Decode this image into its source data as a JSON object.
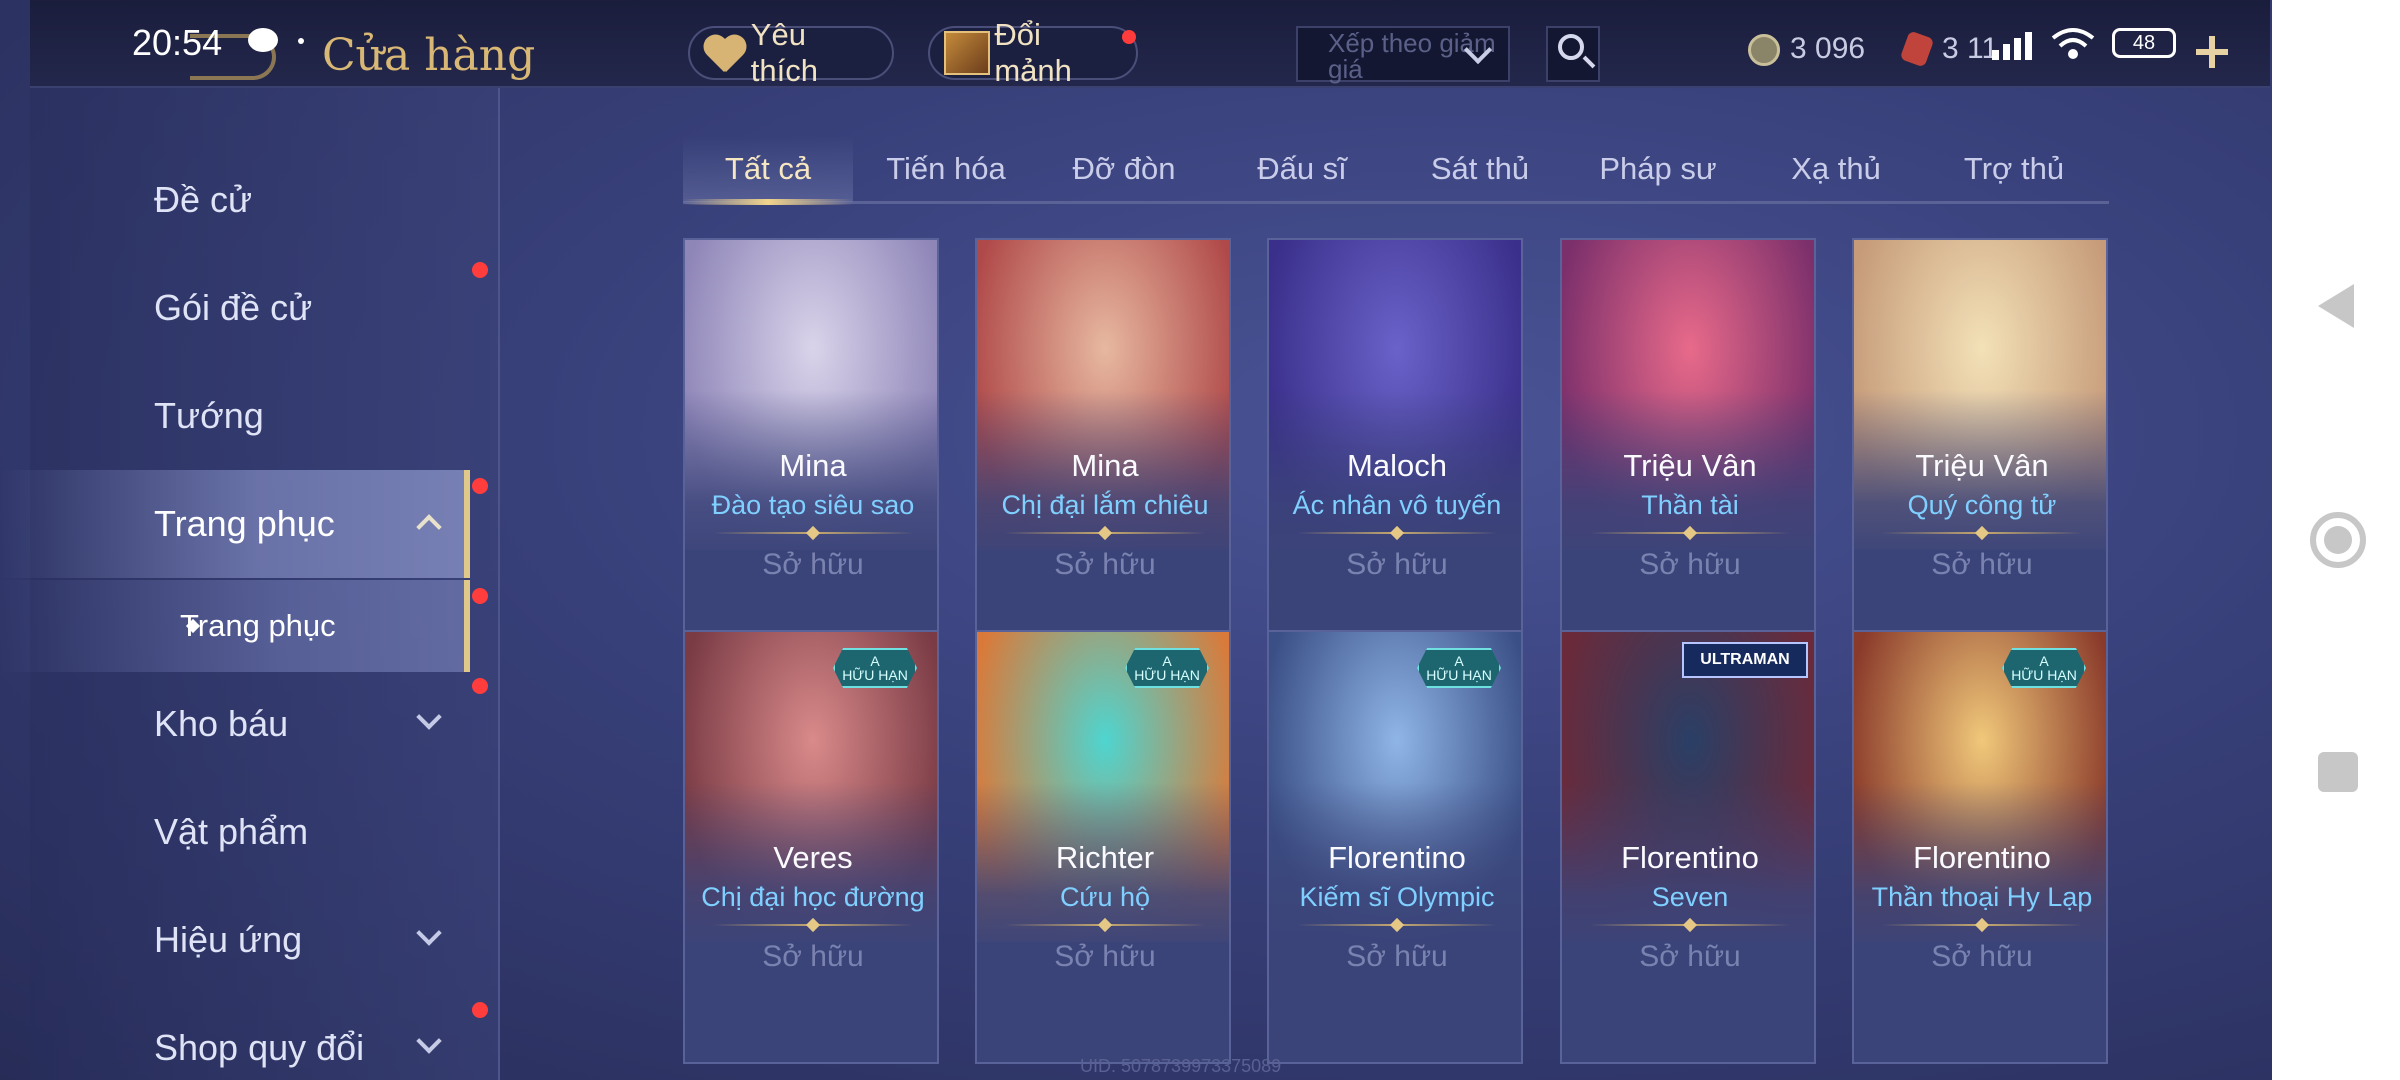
{
  "status": {
    "time": "20:54",
    "battery": "48"
  },
  "header": {
    "title": "Cửa hàng",
    "favorites_label": "Yêu thích",
    "shards_label": "Đổi mảnh",
    "sort_label": "Xếp theo giảm giá",
    "coins": "3 096",
    "gems": "3 11"
  },
  "sidebar": {
    "items": [
      {
        "label": "Đề cử"
      },
      {
        "label": "Gói đề cử"
      },
      {
        "label": "Tướng"
      },
      {
        "label": "Trang phục"
      },
      {
        "label": "Trang phục"
      },
      {
        "label": "Kho báu"
      },
      {
        "label": "Vật phẩm"
      },
      {
        "label": "Hiệu ứng"
      },
      {
        "label": "Shop quy đổi"
      }
    ]
  },
  "tabs": [
    "Tất cả",
    "Tiến hóa",
    "Đỡ đòn",
    "Đấu sĩ",
    "Sát thủ",
    "Pháp sư",
    "Xạ thủ",
    "Trợ thủ"
  ],
  "cards": [
    {
      "hero": "Mina",
      "skin": "Đào tạo siêu sao",
      "status": "Sở hữu",
      "colors": [
        "#d9d3ea",
        "#8f86b8"
      ]
    },
    {
      "hero": "Mina",
      "skin": "Chị đại lắm chiêu",
      "status": "Sở hữu",
      "colors": [
        "#e7b8a0",
        "#b04a4a"
      ]
    },
    {
      "hero": "Maloch",
      "skin": "Ác nhân vô tuyến",
      "status": "Sở hữu",
      "colors": [
        "#6a62c9",
        "#3a2f8a"
      ]
    },
    {
      "hero": "Triệu Vân",
      "skin": "Thần tài",
      "status": "Sở hữu",
      "colors": [
        "#e86a8a",
        "#7b2f6b"
      ]
    },
    {
      "hero": "Triệu Vân",
      "skin": "Quý công tử",
      "status": "Sở hữu",
      "colors": [
        "#f3e1b8",
        "#c69b7a"
      ]
    },
    {
      "hero": "Veres",
      "skin": "Chị đại học đường",
      "status": "Sở hữu",
      "colors": [
        "#d98a8a",
        "#7a3b45"
      ],
      "badge": "A\nHỮU HẠN"
    },
    {
      "hero": "Richter",
      "skin": "Cứu hộ",
      "status": "Sở hữu",
      "colors": [
        "#4ed5d0",
        "#d97a3a"
      ],
      "badge": "A\nHỮU HẠN"
    },
    {
      "hero": "Florentino",
      "skin": "Kiếm sĩ Olympic",
      "status": "Sở hữu",
      "colors": [
        "#8fb5e6",
        "#3a4f86"
      ],
      "badge": "A\nHỮU HẠN"
    },
    {
      "hero": "Florentino",
      "skin": "Seven",
      "status": "Sở hữu",
      "colors": [
        "#2a3f66",
        "#6b2a3a"
      ],
      "badge_wide": "ULTRAMAN"
    },
    {
      "hero": "Florentino",
      "skin": "Thần thoại Hy Lạp",
      "status": "Sở hữu",
      "colors": [
        "#f0c87a",
        "#8a3a2a"
      ],
      "badge": "A\nHỮU HẠN"
    }
  ],
  "footer": {
    "uid": "UID: 5078739973375089"
  },
  "accent_colors": {
    "gold": "#d9b775",
    "skin_name": "#7fd0ff",
    "notification": "#ff3d3d"
  }
}
